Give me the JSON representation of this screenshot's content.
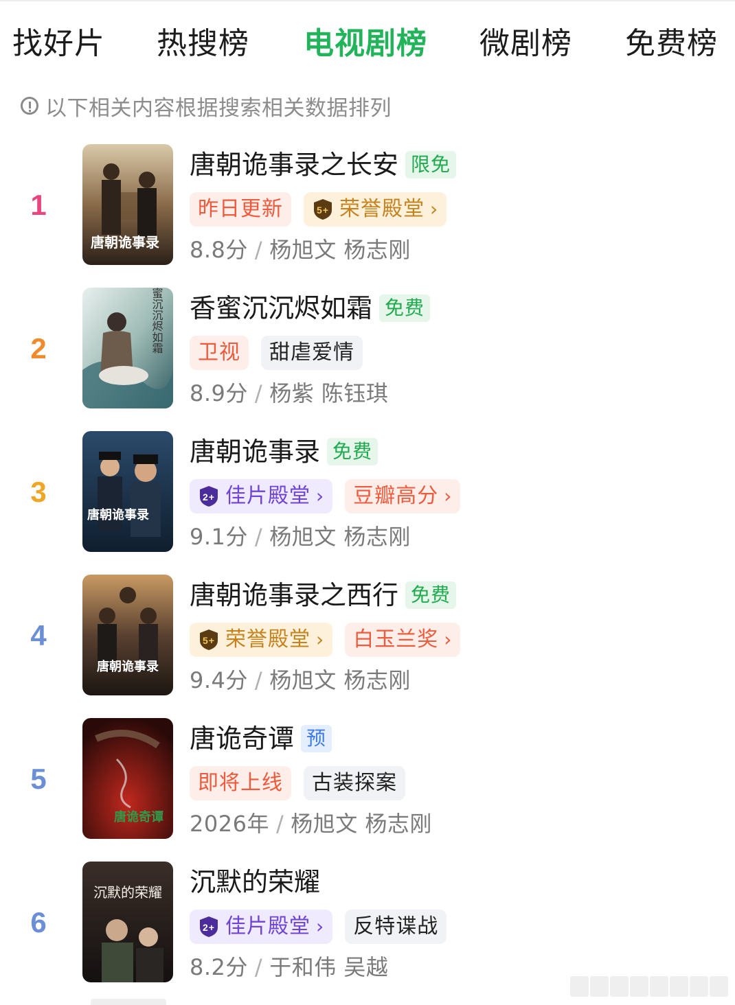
{
  "tabs": [
    {
      "label": "找好片",
      "active": false
    },
    {
      "label": "热搜榜",
      "active": false
    },
    {
      "label": "电视剧榜",
      "active": true
    },
    {
      "label": "微剧榜",
      "active": false
    },
    {
      "label": "免费榜",
      "active": false
    }
  ],
  "notice": {
    "icon": "info-icon",
    "text": "以下相关内容根据搜索相关数据排列"
  },
  "colors": {
    "active_tab": "#22b45a",
    "rank_1": "#e8467c",
    "rank_2": "#f08a2a",
    "rank_3": "#f0a524",
    "rank_other": "#6b8fd6"
  },
  "items": [
    {
      "rank": "1",
      "title": "唐朝诡事录之长安",
      "badge": "限免",
      "tags": [
        {
          "label": "昨日更新",
          "style": "red"
        },
        {
          "label": "荣誉殿堂",
          "style": "gold",
          "icon": "5+"
        }
      ],
      "score": "8.8分",
      "cast": "杨旭文 杨志刚",
      "poster_text": "唐朝诡事录"
    },
    {
      "rank": "2",
      "title": "香蜜沉沉烬如霜",
      "badge": "免费",
      "tags": [
        {
          "label": "卫视",
          "style": "red"
        },
        {
          "label": "甜虐爱情",
          "style": "gray"
        }
      ],
      "score": "8.9分",
      "cast": "杨紫 陈钰琪",
      "poster_text": "香蜜沉沉烬如霜"
    },
    {
      "rank": "3",
      "title": "唐朝诡事录",
      "badge": "免费",
      "tags": [
        {
          "label": "佳片殿堂",
          "style": "purple",
          "icon": "2+"
        },
        {
          "label": "豆瓣高分",
          "style": "red"
        }
      ],
      "score": "9.1分",
      "cast": "杨旭文 杨志刚",
      "poster_text": "唐朝诡事录"
    },
    {
      "rank": "4",
      "title": "唐朝诡事录之西行",
      "badge": "免费",
      "tags": [
        {
          "label": "荣誉殿堂",
          "style": "gold",
          "icon": "5+"
        },
        {
          "label": "白玉兰奖",
          "style": "red"
        }
      ],
      "score": "9.4分",
      "cast": "杨旭文 杨志刚",
      "poster_text": "唐朝诡事录"
    },
    {
      "rank": "5",
      "title": "唐诡奇谭",
      "badge": "预",
      "tags": [
        {
          "label": "即将上线",
          "style": "red"
        },
        {
          "label": "古装探案",
          "style": "gray"
        }
      ],
      "score": "2026年",
      "cast": "杨旭文 杨志刚",
      "poster_text": "唐诡奇谭"
    },
    {
      "rank": "6",
      "title": "沉默的荣耀",
      "badge": "",
      "tags": [
        {
          "label": "佳片殿堂",
          "style": "purple",
          "icon": "2+"
        },
        {
          "label": "反特谍战",
          "style": "gray"
        }
      ],
      "score": "8.2分",
      "cast": "于和伟 吴越",
      "poster_text": "沉默的荣耀"
    }
  ]
}
